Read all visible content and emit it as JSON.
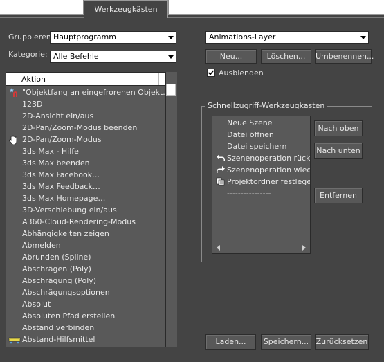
{
  "tabs": {
    "active": "Werkzeugkästen"
  },
  "left": {
    "group_label": "Gruppieren:",
    "group_value": "Hauptprogramm",
    "category_label": "Kategorie:",
    "category_value": "Alle Befehle",
    "column_header": "Aktion",
    "items": [
      {
        "label": "\"Objektfang an eingefrorenen Objekt...",
        "icon": "snap-icon"
      },
      {
        "label": "123D",
        "icon": ""
      },
      {
        "label": "2D-Ansicht ein/aus",
        "icon": ""
      },
      {
        "label": "2D-Pan/Zoom-Modus beenden",
        "icon": ""
      },
      {
        "label": "2D-Pan/Zoom-Modus",
        "icon": "hand-icon"
      },
      {
        "label": "3ds Max - Hilfe",
        "icon": ""
      },
      {
        "label": "3ds Max beenden",
        "icon": ""
      },
      {
        "label": "3ds Max Facebook…",
        "icon": ""
      },
      {
        "label": "3ds Max Feedback…",
        "icon": ""
      },
      {
        "label": "3ds Max Homepage…",
        "icon": ""
      },
      {
        "label": "3D-Verschiebung ein/aus",
        "icon": ""
      },
      {
        "label": "A360-Cloud-Rendering-Modus",
        "icon": ""
      },
      {
        "label": "Abhängigkeiten zeigen",
        "icon": ""
      },
      {
        "label": "Abmelden",
        "icon": ""
      },
      {
        "label": "Abrunden (Spline)",
        "icon": ""
      },
      {
        "label": "Abschrägen (Poly)",
        "icon": ""
      },
      {
        "label": "Abschrägung (Poly)",
        "icon": ""
      },
      {
        "label": "Abschrägungsoptionen",
        "icon": ""
      },
      {
        "label": "Absolut",
        "icon": ""
      },
      {
        "label": "Absoluten Pfad erstellen",
        "icon": ""
      },
      {
        "label": "Abstand verbinden",
        "icon": ""
      },
      {
        "label": "Abstand-Hilfsmittel",
        "icon": "ruler-icon"
      }
    ]
  },
  "right": {
    "layer_select": "Animations-Layer",
    "new_button": "Neu...",
    "delete_button": "Löschen...",
    "rename_button": "Umbenennen...",
    "hide_label": "Ausblenden",
    "hide_checked": true,
    "quick_group_title": "Schnellzugriff-Werkzeugkasten",
    "quick_items": [
      {
        "label": "Neue Szene",
        "icon": ""
      },
      {
        "label": "Datei öffnen",
        "icon": ""
      },
      {
        "label": "Datei speichern",
        "icon": ""
      },
      {
        "label": "Szenenoperation rückgängig",
        "icon": "undo-icon"
      },
      {
        "label": "Szenenoperation wiederherstellen",
        "icon": "redo-icon"
      },
      {
        "label": "Projektordner festlegen...",
        "icon": "project-folder-icon"
      },
      {
        "label": "----------------",
        "icon": ""
      }
    ],
    "move_up_button": "Nach oben",
    "move_down_button": "Nach unten",
    "remove_button": "Entfernen"
  },
  "footer": {
    "load_button": "Laden...",
    "save_button": "Speichern...",
    "reset_button": "Zurücksetzen"
  }
}
